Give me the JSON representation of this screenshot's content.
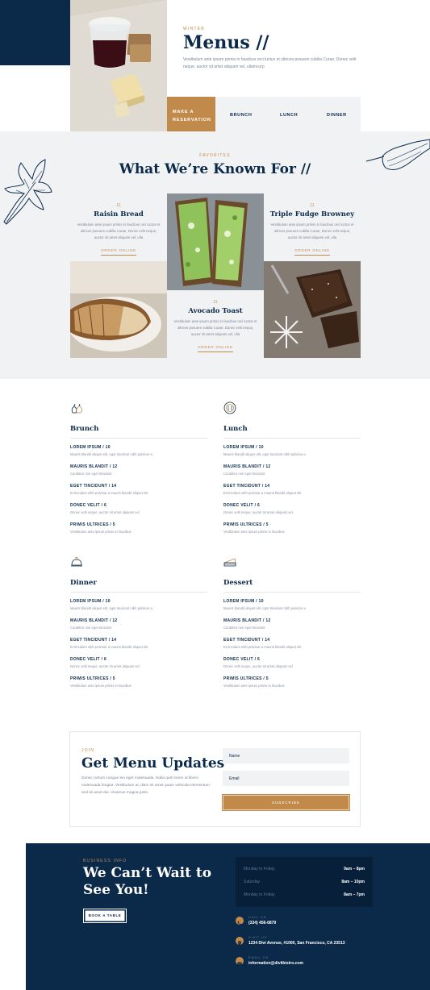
{
  "hero": {
    "eyebrow": "WINTER",
    "title": "Menus //",
    "description": "Vestibulum ante ipsum primis in faucibus orci luctus et ultrices posuere cubilia Curae; Donec velit neque, auctor sit amet aliquam vel, ullamcorp",
    "reserve_label_line1": "MAKE A",
    "reserve_label_line2": "RESERVATION",
    "tabs": [
      "BRUNCH",
      "LUNCH",
      "DINNER"
    ]
  },
  "favorites": {
    "eyebrow": "FAVORITES",
    "title": "What We’re Known For //",
    "items": [
      {
        "num": "11",
        "name": "Raisin Bread",
        "desc": "Vestibulum ante ipsum primis in faucibus orci luctus et ultrices posuere cubilia Curae; Donec velit neque, auctor sit amet aliquam vel, ulla",
        "link": "ORDER ONLINE"
      },
      {
        "num": "11",
        "name": "Triple Fudge Browney",
        "desc": "Vestibulum ante ipsum primis in faucibus orci luctus et ultrices posuere cubilia Curae; Donec velit neque, auctor sit amet aliquam vel, ulla",
        "link": "ORDER ONLINE"
      },
      {
        "num": "11",
        "name": "Avocado Toast",
        "desc": "Vestibulum ante ipsum primis in faucibus orci luctus et ultrices posuere cubilia Curae; Donec velit neque, auctor sit amet aliquam vel, ulla",
        "link": "ORDER ONLINE"
      }
    ]
  },
  "menus": [
    {
      "title": "Brunch",
      "icon": "pear-icon",
      "items": [
        {
          "name": "LOREM IPSUM / 10",
          "desc": "Mauris blandit aliquet elit, eget tincidunt nibh pulvinar a"
        },
        {
          "name": "MAURIS BLANDIT / 12",
          "desc": "Curabitur non eget tincidunt"
        },
        {
          "name": "EGET TINCIDUNT / 14",
          "desc": "Et tincidunt nibh pulvinar a mauris blandit aliquet elit"
        },
        {
          "name": "DONEC VELIT / 6",
          "desc": "Donec velit neque, auctor sit amet aliquam vel"
        },
        {
          "name": "PRIMIS ULTRICES / 5",
          "desc": "Vestibulum ante ipsum primis in faucibus"
        }
      ]
    },
    {
      "title": "Lunch",
      "icon": "plate-icon",
      "items": [
        {
          "name": "LOREM IPSUM / 10",
          "desc": "Mauris blandit aliquet elit, eget tincidunt nibh pulvinar a"
        },
        {
          "name": "MAURIS BLANDIT / 12",
          "desc": "Curabitur non eget tincidunt"
        },
        {
          "name": "EGET TINCIDUNT / 14",
          "desc": "Et tincidunt nibh pulvinar a mauris blandit aliquet elit"
        },
        {
          "name": "DONEC VELIT / 6",
          "desc": "Donec velit neque, auctor sit amet aliquam vel"
        },
        {
          "name": "PRIMIS ULTRICES / 5",
          "desc": "Vestibulum ante ipsum primis in faucibus"
        }
      ]
    },
    {
      "title": "Dinner",
      "icon": "cloche-icon",
      "items": [
        {
          "name": "LOREM IPSUM / 10",
          "desc": "Mauris blandit aliquet elit, eget tincidunt nibh pulvinar a"
        },
        {
          "name": "MAURIS BLANDIT / 12",
          "desc": "Curabitur non eget tincidunt"
        },
        {
          "name": "EGET TINCIDUNT / 14",
          "desc": "Et tincidunt nibh pulvinar a mauris blandit aliquet elit"
        },
        {
          "name": "DONEC VELIT / 6",
          "desc": "Donec velit neque, auctor sit amet aliquam vel"
        },
        {
          "name": "PRIMIS ULTRICES / 5",
          "desc": "Vestibulum ante ipsum primis in faucibus"
        }
      ]
    },
    {
      "title": "Dessert",
      "icon": "cake-slice-icon",
      "items": [
        {
          "name": "LOREM IPSUM / 10",
          "desc": "Mauris blandit aliquet elit, eget tincidunt nibh pulvinar a"
        },
        {
          "name": "MAURIS BLANDIT / 12",
          "desc": "Curabitur non eget tincidunt"
        },
        {
          "name": "EGET TINCIDUNT / 14",
          "desc": "Et tincidunt nibh pulvinar a mauris blandit aliquet elit"
        },
        {
          "name": "DONEC VELIT / 6",
          "desc": "Donec velit neque, auctor sit amet aliquam vel"
        },
        {
          "name": "PRIMIS ULTRICES / 5",
          "desc": "Vestibulum ante ipsum primis in faucibus"
        }
      ]
    }
  ],
  "newsletter": {
    "eyebrow": "JOIN",
    "title": "Get Menu Updates",
    "description": "Donec rutrum congue leo eget malesuada. Nulla quis lorem ut libero malesuada feugiat. Vestibulum ac diam sit amet quam vehicula elementum sed sit amet dui. Vivamus magna justo.",
    "name_placeholder": "Name",
    "email_placeholder": "Email",
    "subscribe_label": "SUBSCRIBE"
  },
  "footer": {
    "eyebrow": "BUSINESS INFO",
    "title": "We Can’t Wait to See You!",
    "book_label": "BOOK A TABLE",
    "hours": [
      {
        "day": "Monday to Friday",
        "time": "9am – 8pm"
      },
      {
        "day": "Saturday",
        "time": "8am – 10pm"
      },
      {
        "day": "Monday to Friday",
        "time": "8am – 7pm"
      }
    ],
    "contacts": [
      {
        "label": "CALL US",
        "value": "(334) 456-6879",
        "icon": "phone-icon"
      },
      {
        "label": "VISIT US",
        "value": "1234 Divi Avenue, #1000, San Francisco, CA 23513",
        "icon": "map-pin-icon"
      },
      {
        "label": "EMAIL US",
        "value": "information@diviibistro.com",
        "icon": "mail-icon"
      }
    ]
  },
  "colors": {
    "navy": "#0b2a4a",
    "gold": "#c28a4a",
    "band": "#f1f2f4"
  }
}
